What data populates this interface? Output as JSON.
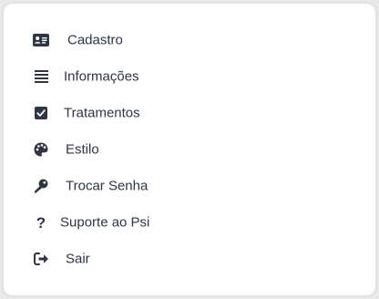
{
  "menu": {
    "items": [
      {
        "label": "Cadastro",
        "icon": "id-card-icon"
      },
      {
        "label": "Informações",
        "icon": "list-icon"
      },
      {
        "label": "Tratamentos",
        "icon": "checkbox-icon"
      },
      {
        "label": "Estilo",
        "icon": "palette-icon"
      },
      {
        "label": "Trocar Senha",
        "icon": "key-icon"
      },
      {
        "label": "Suporte ao Psi",
        "icon": "question-icon"
      },
      {
        "label": "Sair",
        "icon": "sign-out-icon"
      }
    ]
  },
  "colors": {
    "text": "#2f3542",
    "icon": "#2f3542",
    "card": "#ffffff",
    "background": "#e9e9eb"
  }
}
